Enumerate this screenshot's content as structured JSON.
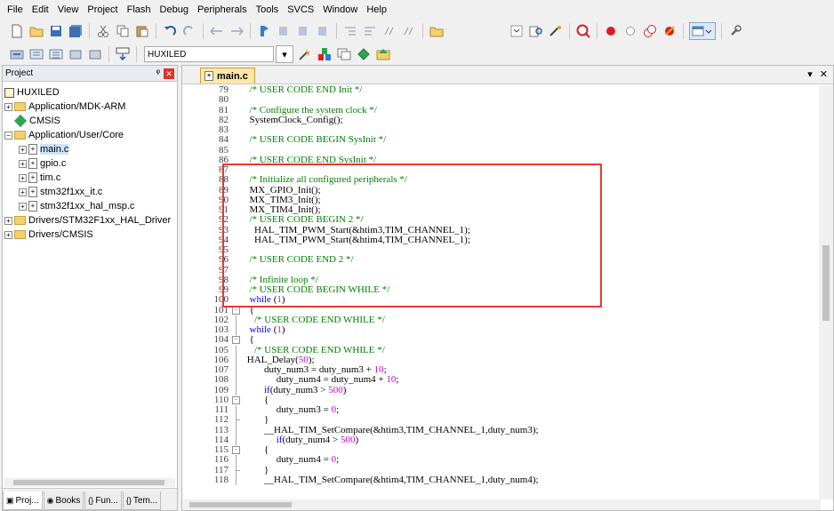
{
  "menu": [
    "File",
    "Edit",
    "View",
    "Project",
    "Flash",
    "Debug",
    "Peripherals",
    "Tools",
    "SVCS",
    "Window",
    "Help"
  ],
  "toolbar": {
    "target": "HUXILED",
    "dropdown_arrow": "▾"
  },
  "project_panel": {
    "title": "Project",
    "pin": "ᵠ",
    "close": "✕",
    "tree": {
      "root": "HUXILED",
      "group_mdk": "Application/MDK-ARM",
      "cmsis": "CMSIS",
      "group_core": "Application/User/Core",
      "files": [
        "main.c",
        "gpio.c",
        "tim.c",
        "stm32f1xx_it.c",
        "stm32f1xx_hal_msp.c"
      ],
      "group_hal": "Drivers/STM32F1xx_HAL_Driver",
      "group_cmsis": "Drivers/CMSIS"
    },
    "tabs": [
      "Proj...",
      "Books",
      "Fun...",
      "Tem..."
    ],
    "tab_icons": [
      "▣",
      "◉",
      "{}",
      "{}"
    ]
  },
  "editor": {
    "tab_label": "main.c",
    "tab_controls": [
      "▾",
      "✕"
    ],
    "lines": [
      {
        "n": "79",
        "t": "  /* USER CODE END Init */"
      },
      {
        "n": "80",
        "t": ""
      },
      {
        "n": "81",
        "t": "  /* Configure the system clock */"
      },
      {
        "n": "82",
        "t": "  SystemClock_Config();"
      },
      {
        "n": "83",
        "t": ""
      },
      {
        "n": "84",
        "t": "  /* USER CODE BEGIN SysInit */"
      },
      {
        "n": "85",
        "t": ""
      },
      {
        "n": "86",
        "t": "  /* USER CODE END SysInit */"
      },
      {
        "n": "87",
        "t": ""
      },
      {
        "n": "88",
        "t": "  /* Initialize all configured peripherals */"
      },
      {
        "n": "89",
        "t": "  MX_GPIO_Init();"
      },
      {
        "n": "90",
        "t": "  MX_TIM3_Init();"
      },
      {
        "n": "91",
        "t": "  MX_TIM4_Init();"
      },
      {
        "n": "92",
        "t": "  /* USER CODE BEGIN 2 */"
      },
      {
        "n": "93",
        "t": "    HAL_TIM_PWM_Start(&htim3,TIM_CHANNEL_1);"
      },
      {
        "n": "94",
        "t": "    HAL_TIM_PWM_Start(&htim4,TIM_CHANNEL_1);"
      },
      {
        "n": "95",
        "t": ""
      },
      {
        "n": "96",
        "t": "  /* USER CODE END 2 */"
      },
      {
        "n": "97",
        "t": ""
      },
      {
        "n": "98",
        "t": "  /* Infinite loop */"
      },
      {
        "n": "99",
        "t": "  /* USER CODE BEGIN WHILE */"
      },
      {
        "n": "100",
        "t": "  while (1)"
      },
      {
        "n": "101",
        "t": "  {"
      },
      {
        "n": "102",
        "t": "    /* USER CODE END WHILE */"
      },
      {
        "n": "103",
        "t": "  while (1)"
      },
      {
        "n": "104",
        "t": "  {"
      },
      {
        "n": "105",
        "t": "    /* USER CODE END WHILE */"
      },
      {
        "n": "106",
        "t": " HAL_Delay(50);"
      },
      {
        "n": "107",
        "t": "        duty_num3 = duty_num3 + 10;"
      },
      {
        "n": "108",
        "t": "             duty_num4 = duty_num4 + 10;"
      },
      {
        "n": "109",
        "t": "        if(duty_num3 > 500)"
      },
      {
        "n": "110",
        "t": "        {"
      },
      {
        "n": "111",
        "t": "             duty_num3 = 0;"
      },
      {
        "n": "112",
        "t": "        }"
      },
      {
        "n": "113",
        "t": "        __HAL_TIM_SetCompare(&htim3,TIM_CHANNEL_1,duty_num3);"
      },
      {
        "n": "114",
        "t": "             if(duty_num4 > 500)"
      },
      {
        "n": "115",
        "t": "        {"
      },
      {
        "n": "116",
        "t": "             duty_num4 = 0;"
      },
      {
        "n": "117",
        "t": "        }"
      },
      {
        "n": "118",
        "t": "        __HAL_TIM_SetCompare(&htim4,TIM_CHANNEL_1,duty_num4);"
      }
    ]
  },
  "colors": {
    "comment": "#008000",
    "keyword": "#0000ff",
    "number": "#d000d0",
    "highlight_border": "#e53935",
    "active_tab": "#ffe7a8"
  }
}
